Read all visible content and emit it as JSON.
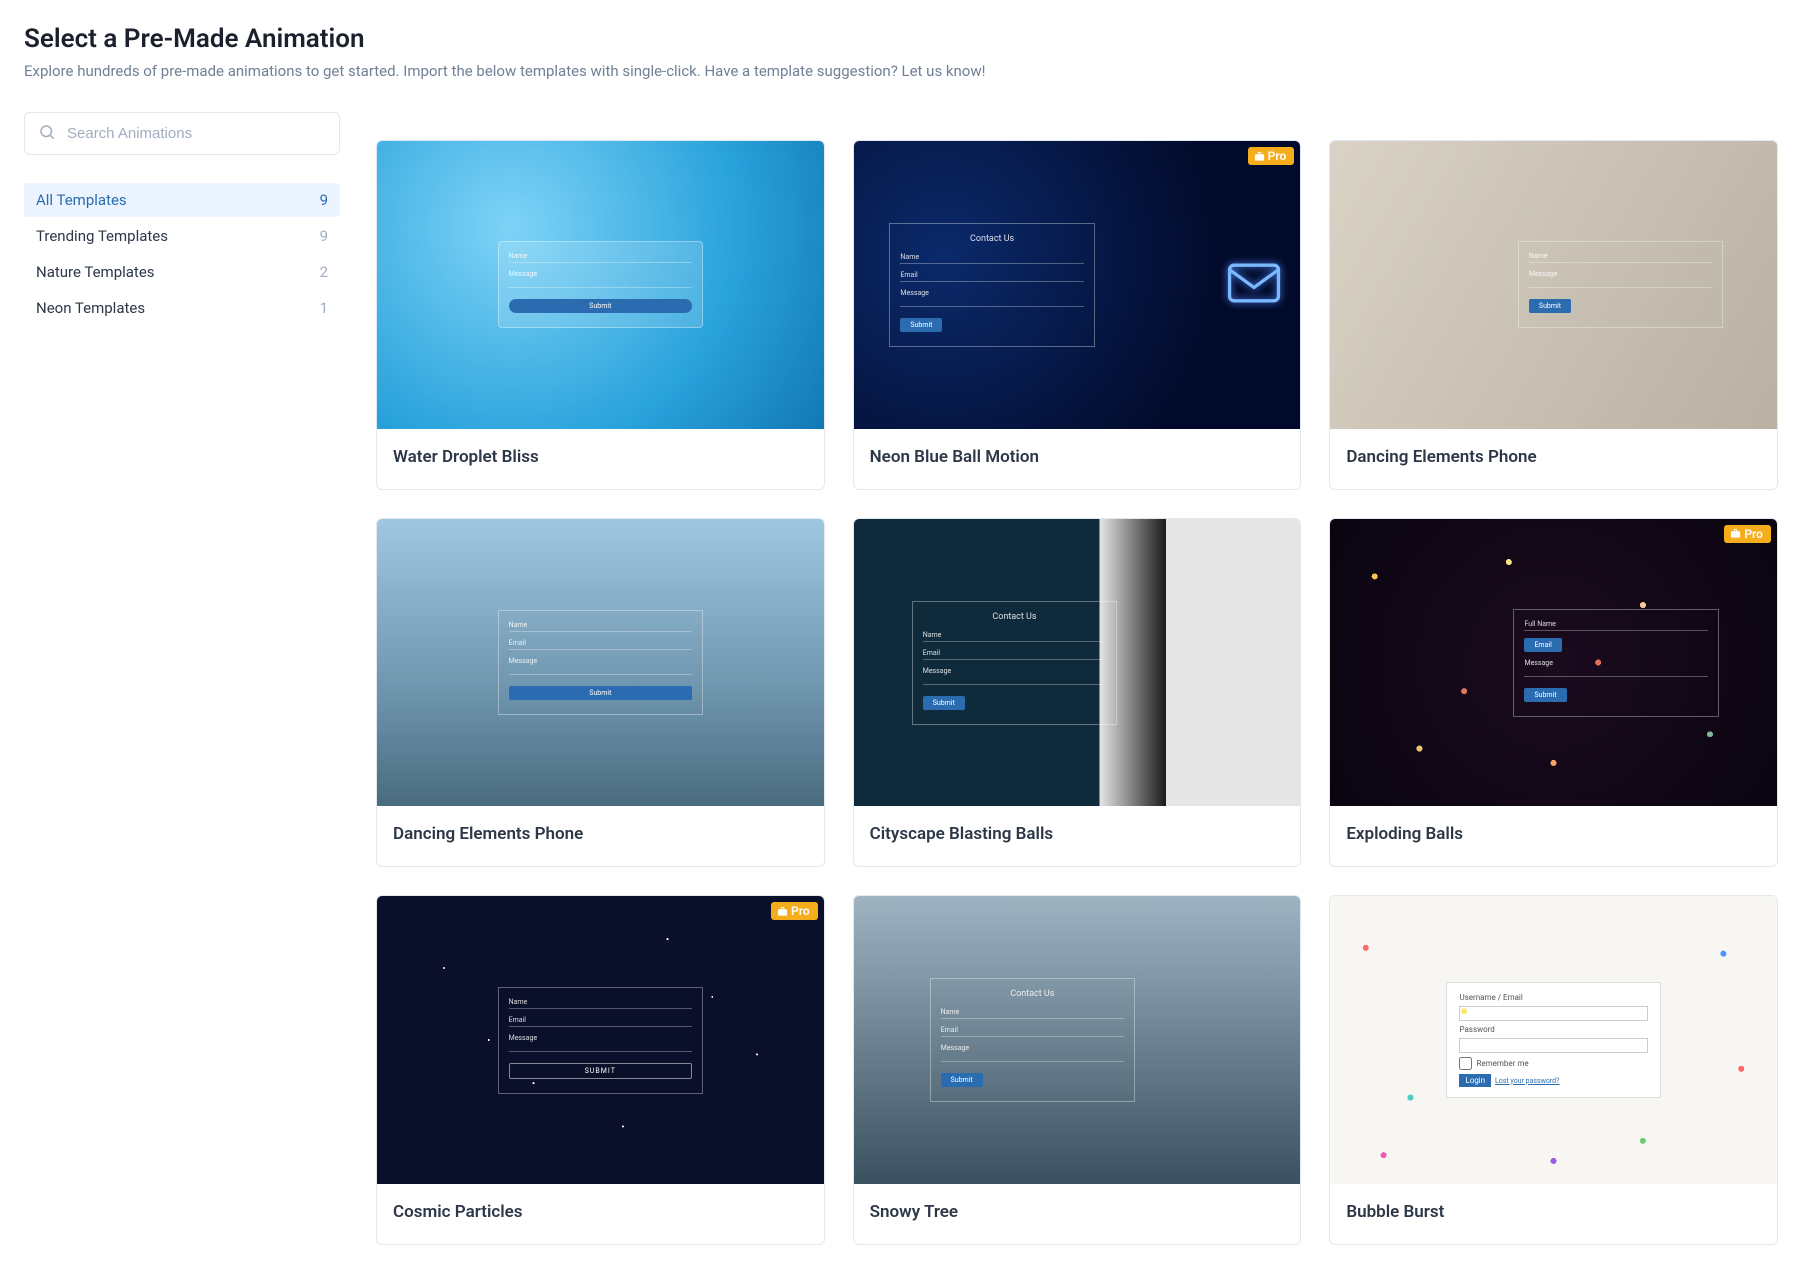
{
  "header": {
    "title": "Select a Pre-Made Animation",
    "subtitle": "Explore hundreds of pre-made animations to get started. Import the below templates with single-click. Have a template suggestion? Let us know!"
  },
  "search": {
    "placeholder": "Search Animations"
  },
  "badges": {
    "pro": "Pro"
  },
  "categories": [
    {
      "label": "All Templates",
      "count": "9",
      "active": true
    },
    {
      "label": "Trending Templates",
      "count": "9",
      "active": false
    },
    {
      "label": "Nature Templates",
      "count": "2",
      "active": false
    },
    {
      "label": "Neon Templates",
      "count": "1",
      "active": false
    }
  ],
  "mock": {
    "contact_us": "Contact Us",
    "name": "Name",
    "full_name": "Full Name",
    "email": "Email",
    "message": "Message",
    "submit": "Submit",
    "submit_upper": "SUBMIT",
    "username_email": "Username / Email",
    "password": "Password",
    "remember_me": "Remember me",
    "login": "Login",
    "lost_password": "Lost your password?"
  },
  "templates": [
    {
      "title": "Water Droplet Bliss",
      "pro": false,
      "bg": "bg-water",
      "variant": "water"
    },
    {
      "title": "Neon Blue Ball Motion",
      "pro": true,
      "bg": "bg-neonblue",
      "variant": "neon"
    },
    {
      "title": "Dancing Elements Phone",
      "pro": false,
      "bg": "bg-phone",
      "variant": "phone"
    },
    {
      "title": "Dancing Elements Phone",
      "pro": false,
      "bg": "bg-city",
      "variant": "city"
    },
    {
      "title": "Cityscape Blasting Balls",
      "pro": false,
      "bg": "bg-suit",
      "variant": "suit"
    },
    {
      "title": "Exploding Balls",
      "pro": true,
      "bg": "bg-explode",
      "variant": "explode"
    },
    {
      "title": "Cosmic Particles",
      "pro": true,
      "bg": "bg-cosmic",
      "variant": "cosmic"
    },
    {
      "title": "Snowy Tree",
      "pro": false,
      "bg": "bg-snow",
      "variant": "snow"
    },
    {
      "title": "Bubble Burst",
      "pro": false,
      "bg": "bg-bubble",
      "variant": "bubble"
    }
  ]
}
